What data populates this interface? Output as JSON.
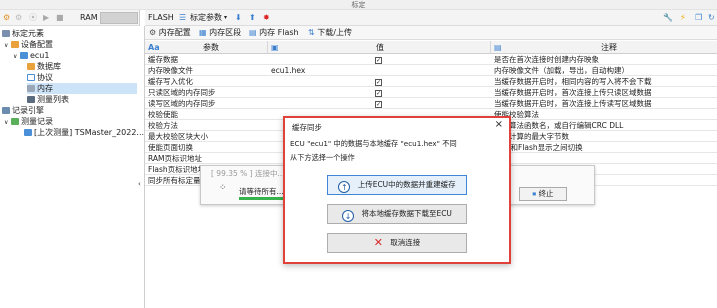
{
  "window": {
    "title": "标定"
  },
  "left_toolbar": {
    "ram_label": "RAM"
  },
  "right_toolbar": {
    "flash_label": "FLASH",
    "calib_params": "标定参数"
  },
  "tabs": [
    "内存配置",
    "内存区段",
    "内存 Flash",
    "下载/上传"
  ],
  "tree": {
    "root": "标定元素",
    "device_config": "设备配置",
    "ecu": "ecu1",
    "database": "数据库",
    "protocol": "协议",
    "memory": "内存",
    "measure_list": "测量列表",
    "record_engine": "记录引擎",
    "measure_record": "测量记录",
    "record_item": "[上次测量] TSMaster_2022..."
  },
  "grid": {
    "headers": {
      "param": "参数",
      "value": "值",
      "comment": "注释"
    },
    "rows": [
      {
        "param": "缓存数据",
        "value": "",
        "check": true,
        "comment": "是否在首次连接时创建内存映象"
      },
      {
        "param": "内存映像文件",
        "value": "ecu1.hex",
        "check": false,
        "comment": "内存映像文件（加载，导出，自动构建）"
      },
      {
        "param": "缓存写入优化",
        "value": "",
        "check": true,
        "comment": "当缓存数据开启时，相同内容的写入将不会下载"
      },
      {
        "param": "只读区域的内存同步",
        "value": "",
        "check": true,
        "comment": "当缓存数据开启时，首次连接上传只读区域数据"
      },
      {
        "param": "读写区域的内存同步",
        "value": "",
        "check": true,
        "comment": "当缓存数据开启时，首次连接上传读写区域数据"
      },
      {
        "param": "校验使能",
        "value": "",
        "check": false,
        "comment": "使能校验算法"
      },
      {
        "param": "校验方法",
        "value": "",
        "check": false,
        "comment": "校验算法函数名，或自行编辑CRC DLL"
      },
      {
        "param": "最大校验区块大小",
        "value": "",
        "check": false,
        "comment": "校验计算的最大字节数"
      },
      {
        "param": "使能页面切换",
        "value": "",
        "check": false,
        "comment": "RAM和Flash显示之间切换"
      },
      {
        "param": "RAM页标识地址",
        "value": "",
        "check": false,
        "comment": "地址"
      },
      {
        "param": "Flash页标识地址",
        "value": "",
        "check": false,
        "comment": "地址"
      },
      {
        "param": "同步所有标定量",
        "value": "",
        "check": false,
        "comment": "同步所有的标定变量"
      }
    ]
  },
  "progress_dialog": {
    "title": "[ 99.35 % ] 连接中...",
    "message": "请等待所有...",
    "stop_button": "终止"
  },
  "modal": {
    "title": "缓存同步",
    "close": "×",
    "line1": "ECU \"ecu1\" 中的数据与本地缓存 \"ecu1.hex\" 不同",
    "line2": "从下方选择一个操作",
    "btn_upload": "上传ECU中的数据并重建缓存",
    "btn_download": "将本地缓存数据下载至ECU",
    "btn_cancel": "取消连接"
  }
}
